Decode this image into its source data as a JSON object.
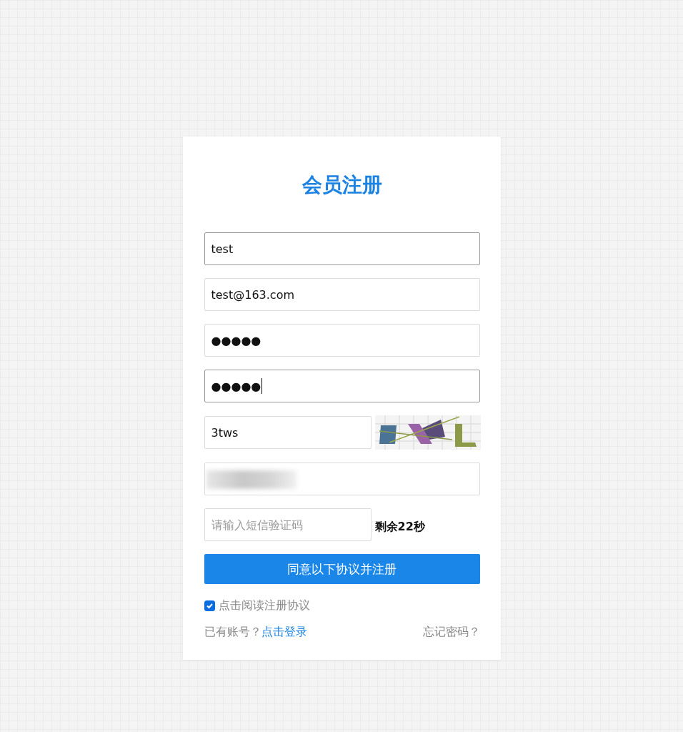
{
  "title": "会员注册",
  "fields": [
    {
      "kind": "text",
      "value": "test",
      "active": true,
      "cursor": false
    },
    {
      "kind": "text",
      "value": "test@163.com",
      "active": false,
      "cursor": false
    },
    {
      "kind": "text",
      "value": "●●●●●",
      "active": false,
      "cursor": false
    },
    {
      "kind": "text",
      "value": "●●●●●",
      "active": true,
      "cursor": true
    },
    {
      "kind": "captcha",
      "value": "3tws",
      "active": false,
      "cursor": false
    },
    {
      "kind": "redacted"
    },
    {
      "kind": "sms",
      "placeholder": "请输入短信验证码",
      "countdown": "剩余22秒"
    }
  ],
  "submit": "同意以下协议并注册",
  "agreement": {
    "label": "点击阅读注册协议",
    "checked": true
  },
  "footer": {
    "prompt": "已有账号？",
    "login_link": "点击登录",
    "forgot_link": "忘记密码？"
  }
}
